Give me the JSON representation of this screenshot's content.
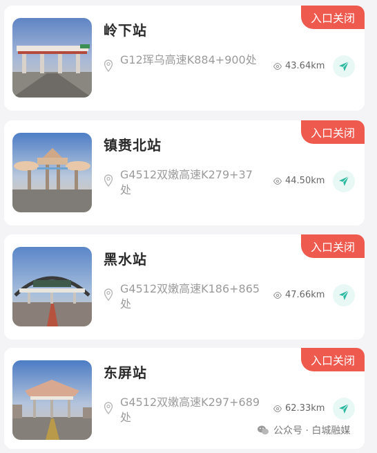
{
  "badge_color": "#ef5a4f",
  "accent_color": "#2bb9a0",
  "stations": [
    {
      "name": "岭下站",
      "address": "G12珲乌高速K884+900处",
      "distance": "43.64km",
      "status": "入口关闭"
    },
    {
      "name": "镇赉北站",
      "address": "G4512双嫩高速K279+37处",
      "distance": "44.50km",
      "status": "入口关闭"
    },
    {
      "name": "黑水站",
      "address": "G4512双嫩高速K186+865处",
      "distance": "47.66km",
      "status": "入口关闭"
    },
    {
      "name": "东屏站",
      "address": "G4512双嫩高速K297+689处",
      "distance": "62.33km",
      "status": "入口关闭"
    }
  ],
  "watermark": {
    "text": "公众号 · 白城融媒"
  }
}
